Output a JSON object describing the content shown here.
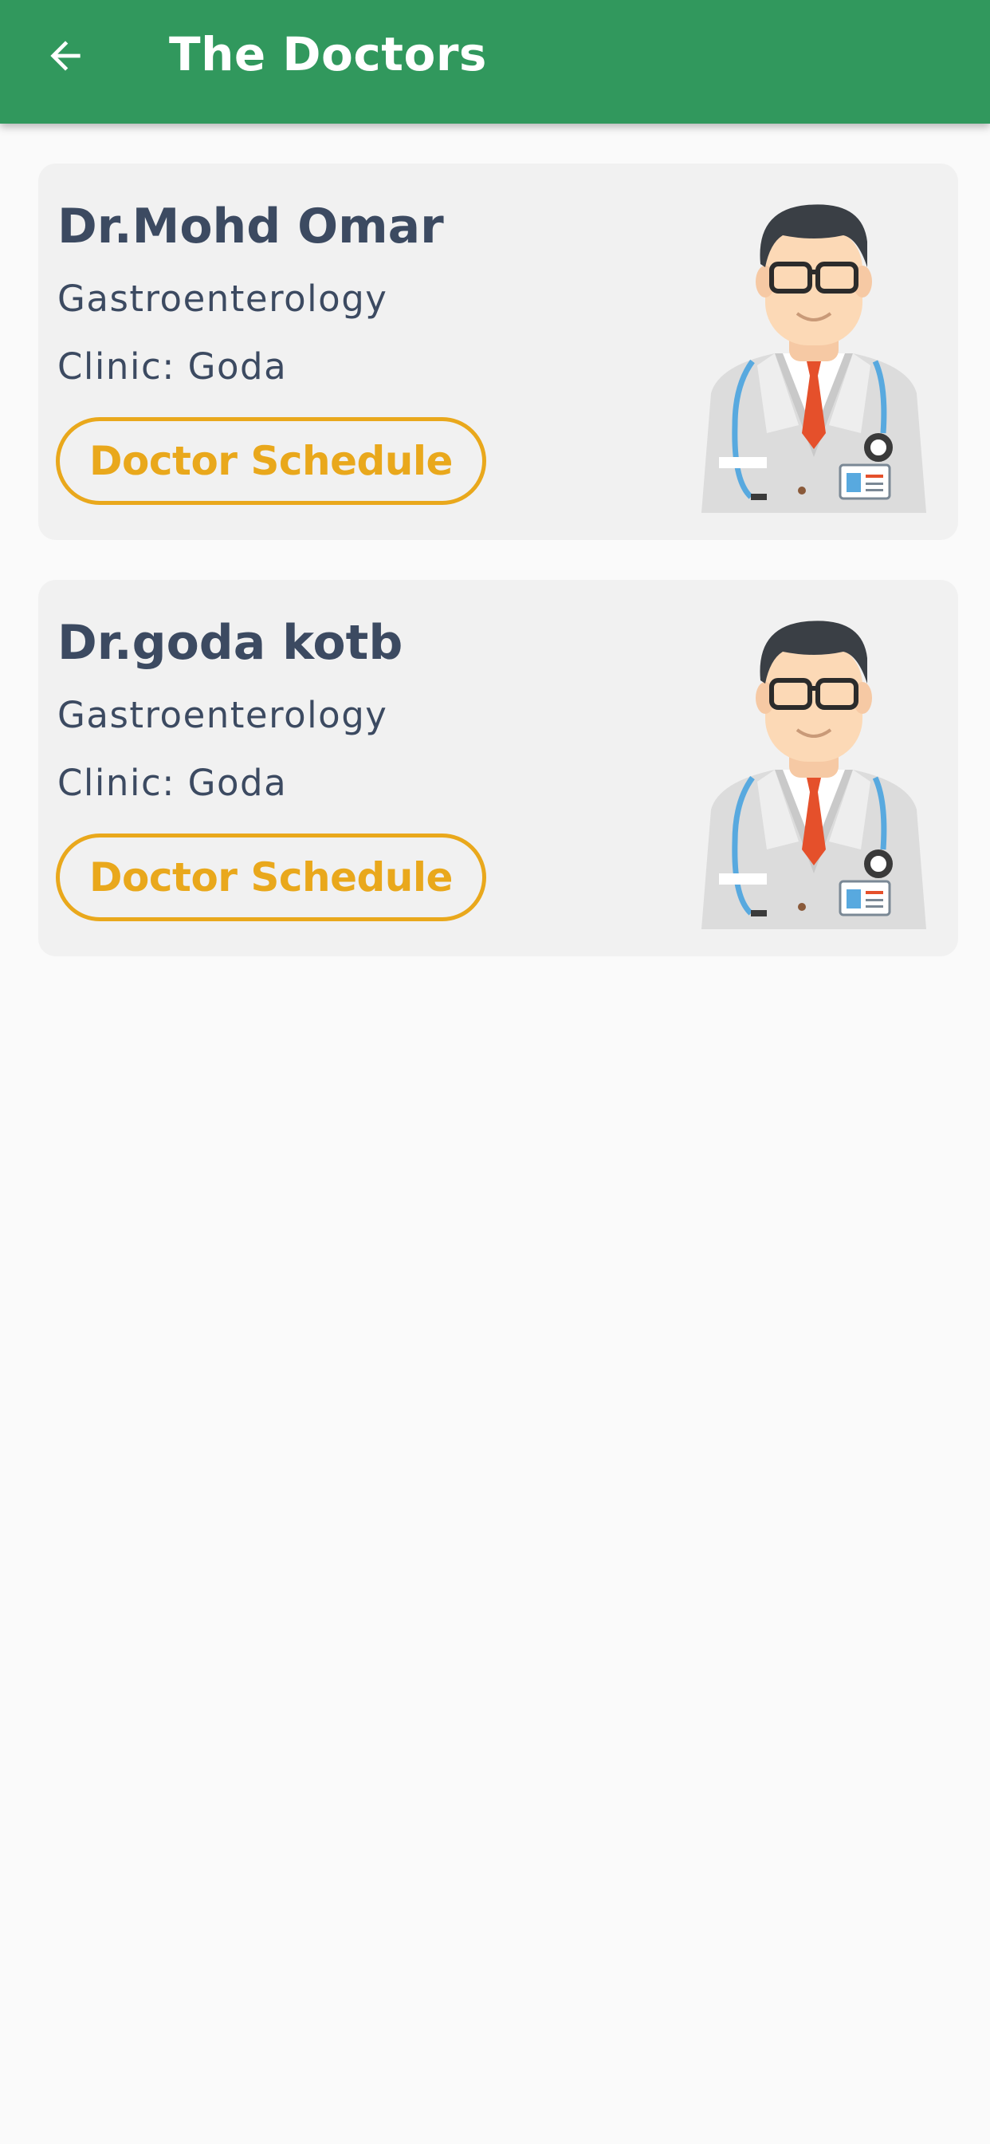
{
  "appbar": {
    "title": "The Doctors",
    "back_icon": "arrow-left-icon",
    "color": "#31985d"
  },
  "doctors": [
    {
      "name": "Dr.Mohd Omar",
      "specialty": "Gastroenterology",
      "clinic": "Clinic: Goda",
      "schedule_label": "Doctor Schedule",
      "avatar_icon": "doctor-avatar-icon"
    },
    {
      "name": "Dr.goda kotb",
      "specialty": "Gastroenterology",
      "clinic": "Clinic: Goda",
      "schedule_label": "Doctor Schedule",
      "avatar_icon": "doctor-avatar-icon"
    }
  ],
  "colors": {
    "accent": "#e9a81c",
    "text": "#3c4a61",
    "card": "#f1f1f1",
    "background": "#fafafa"
  }
}
